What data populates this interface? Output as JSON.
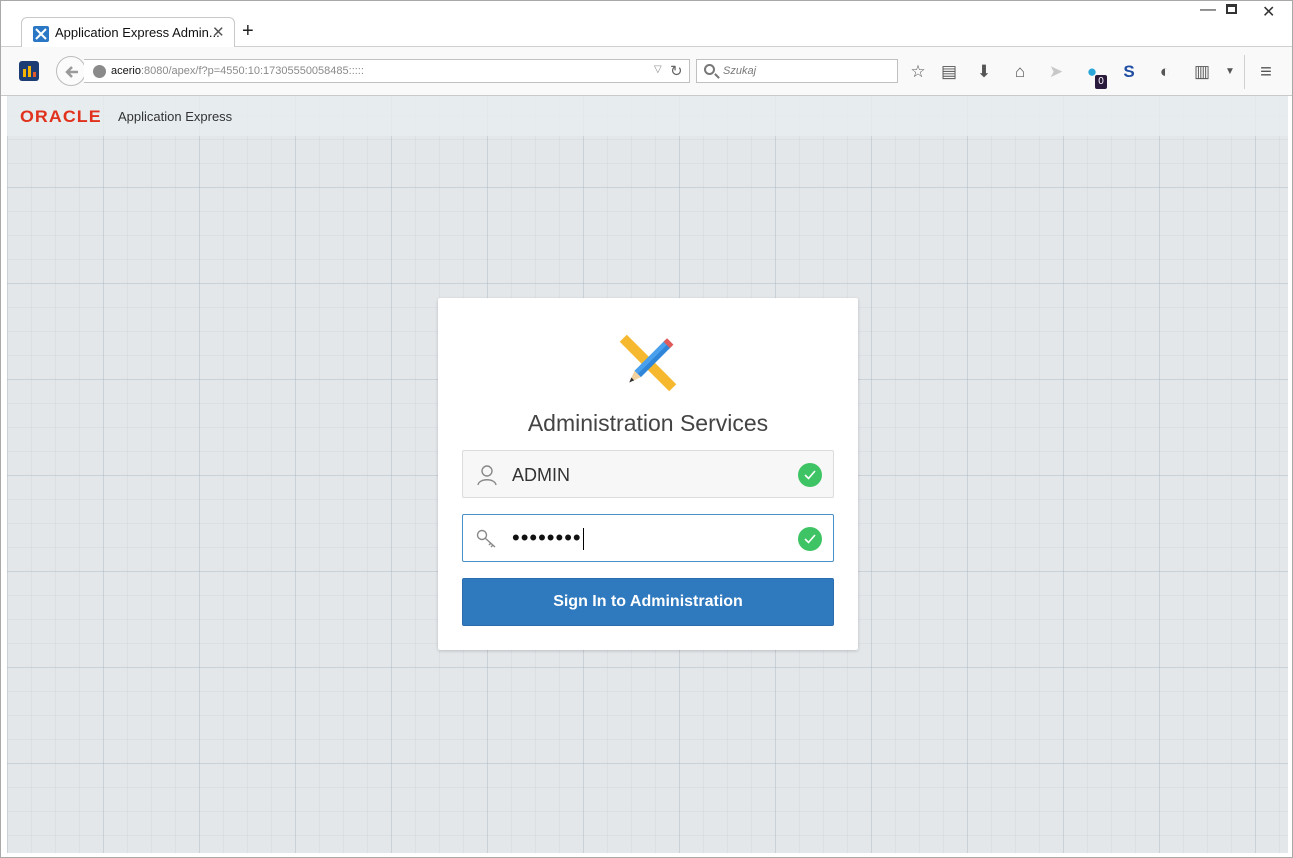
{
  "browser": {
    "tab": {
      "title": "Application Express Admin...",
      "close_glyph": "✕",
      "icon": "apex-favicon-icon"
    },
    "new_tab_glyph": "+",
    "window_controls": {
      "minimize": "—",
      "close": "✕"
    },
    "url": {
      "host": "acerio",
      "rest": ":8080/apex/f?p=4550:10:17305550058485:::::"
    },
    "search": {
      "placeholder": "Szukaj"
    },
    "toolbar_badge": "0"
  },
  "apex": {
    "brand": "ORACLE",
    "product": "Application Express"
  },
  "login": {
    "title": "Administration Services",
    "username": "ADMIN",
    "password_mask": "••••••••",
    "signin_label": "Sign In to Administration"
  },
  "colors": {
    "accent": "#2f79be",
    "oracle_red": "#e0321c",
    "valid": "#3ec464"
  }
}
